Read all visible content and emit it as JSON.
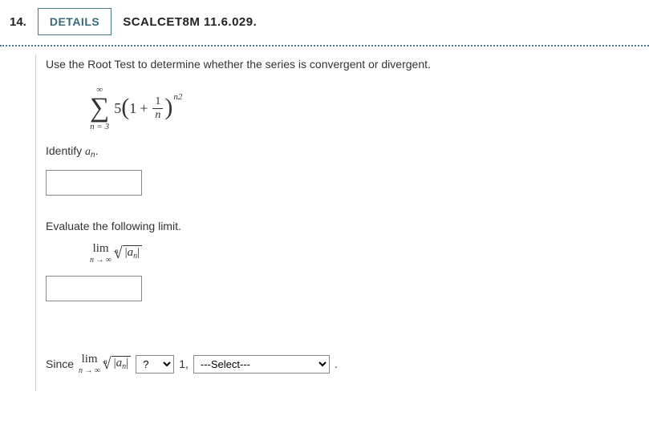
{
  "header": {
    "question_number": "14.",
    "details_label": "DETAILS",
    "source": "SCALCET8M 11.6.029."
  },
  "problem": {
    "instruction": "Use the Root Test to determine whether the series is convergent or divergent.",
    "series": {
      "sigma_upper": "∞",
      "sigma_lower": "n = 3",
      "coeff": "5",
      "lparen": "(",
      "one": "1",
      "plus": "+",
      "frac_num": "1",
      "frac_den": "n",
      "rparen": ")",
      "exponent": "n2"
    },
    "identify_label_pre": "Identify ",
    "identify_var": "a",
    "identify_sub": "n",
    "identify_dot": ".",
    "eval_label": "Evaluate the following limit.",
    "limit": {
      "lim": "lim",
      "under": "n → ∞",
      "root_index": "n",
      "surd": "√",
      "radicand_bar1": "|",
      "radicand_a": "a",
      "radicand_sub": "n",
      "radicand_bar2": "|"
    },
    "conclusion": {
      "since": "Since",
      "one": "1,",
      "period": "."
    },
    "select_compare": "?",
    "select_result": "---Select---"
  }
}
